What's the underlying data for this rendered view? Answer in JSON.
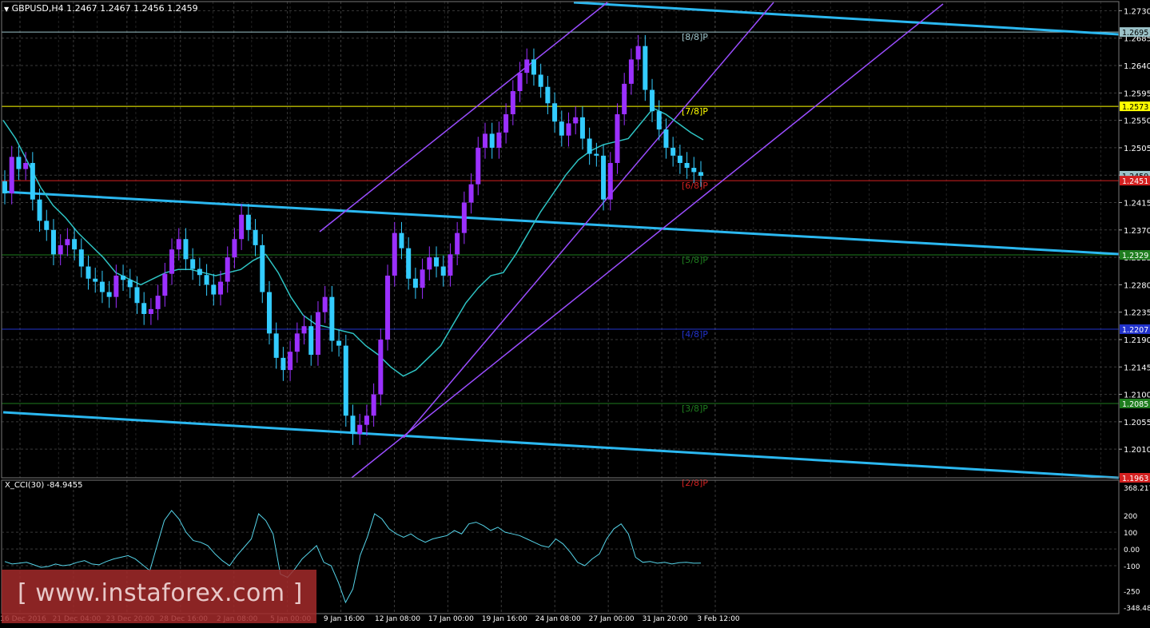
{
  "header": {
    "symbol_label": "GBPUSD,H4  1.2467 1.2467 1.2456 1.2459"
  },
  "indicator": {
    "label": "X_CCI(30) -84.9455"
  },
  "watermark": {
    "text": "[ www.instaforex.com ]"
  },
  "colors": {
    "background": "#000000",
    "grid": "#3a3a3a",
    "bull_candle": "#9b30ff",
    "bear_candle": "#33ccff",
    "ma_line": "#2ec4c4",
    "regression_channel": "#2bb8f0",
    "up_channel": "#9a4dff",
    "cci_line": "#55d3e8",
    "level_8_8": "#9cc3c9",
    "level_7_8": "#ffff00",
    "level_6_8": "#d42020",
    "level_5_8": "#1e7d1e",
    "level_4_8": "#2233cc",
    "level_3_8": "#1e7d1e",
    "level_2_8": "#d42020"
  },
  "chart_data": {
    "type": "candlestick",
    "symbol": "GBPUSD",
    "timeframe": "H4",
    "ohlc_current": [
      1.2467,
      1.2467,
      1.2456,
      1.2459
    ],
    "price_axis_ticks": [
      "1.2730",
      "1.2685",
      "1.2640",
      "1.2595",
      "1.2550",
      "1.2505",
      "1.2460",
      "1.2415",
      "1.2370",
      "1.2325",
      "1.2280",
      "1.2235",
      "1.2190",
      "1.2145",
      "1.2100",
      "1.2055",
      "1.2010"
    ],
    "ylim": [
      1.1963,
      1.2745
    ],
    "time_axis_labels": [
      "16 Dec 2016",
      "21 Dec 04:00",
      "23 Dec 20:00",
      "28 Dec 16:00",
      "2 Jan 08:00",
      "5 Jan 00:00",
      "9 Jan 16:00",
      "12 Jan 08:00",
      "17 Jan 00:00",
      "19 Jan 16:00",
      "24 Jan 08:00",
      "27 Jan 00:00",
      "31 Jan 20:00",
      "3 Feb 12:00"
    ],
    "price_tags": [
      {
        "value": "1.2695",
        "level": 1.2695
      },
      {
        "value": "1.2573",
        "level": 1.2573
      },
      {
        "value": "1.2459",
        "level": 1.2459
      },
      {
        "value": "1.2451",
        "level": 1.2451
      },
      {
        "value": "1.2329",
        "level": 1.2329
      },
      {
        "value": "1.2207",
        "level": 1.2207
      },
      {
        "value": "1.2085",
        "level": 1.2085
      },
      {
        "value": "1.1963",
        "level": 1.1963
      }
    ],
    "murrey_levels": [
      {
        "label": "[8/8]P",
        "value": 1.2695
      },
      {
        "label": "[7/8]P",
        "value": 1.2573
      },
      {
        "label": "[6/8]P",
        "value": 1.2451
      },
      {
        "label": "[5/8]P",
        "value": 1.2329
      },
      {
        "label": "[4/8]P",
        "value": 1.2207
      },
      {
        "label": "[3/8]P",
        "value": 1.2085
      },
      {
        "label": "[2/8]P",
        "value": 1.1963
      }
    ],
    "closes": [
      1.243,
      1.249,
      1.247,
      1.248,
      1.242,
      1.2385,
      1.237,
      1.233,
      1.2345,
      1.2355,
      1.2338,
      1.231,
      1.229,
      1.2285,
      1.2268,
      1.226,
      1.2295,
      1.2288,
      1.2276,
      1.225,
      1.2232,
      1.224,
      1.2262,
      1.2298,
      1.2338,
      1.2355,
      1.2322,
      1.2306,
      1.2296,
      1.228,
      1.2264,
      1.2285,
      1.2325,
      1.2355,
      1.2395,
      1.237,
      1.2345,
      1.2268,
      1.22,
      1.216,
      1.214,
      1.217,
      1.22,
      1.2212,
      1.2165,
      1.2235,
      1.226,
      1.2188,
      1.218,
      1.2065,
      1.2035,
      1.205,
      1.2065,
      1.21,
      1.219,
      1.2295,
      1.2365,
      1.234,
      1.229,
      1.2275,
      1.2305,
      1.2325,
      1.231,
      1.2295,
      1.233,
      1.2365,
      1.2415,
      1.2445,
      1.2505,
      1.2528,
      1.2505,
      1.253,
      1.256,
      1.2598,
      1.2628,
      1.265,
      1.2625,
      1.2605,
      1.2578,
      1.2548,
      1.2525,
      1.2545,
      1.2555,
      1.252,
      1.2495,
      1.2492,
      1.242,
      1.248,
      1.256,
      1.261,
      1.265,
      1.2672,
      1.26,
      1.2565,
      1.2535,
      1.2505,
      1.2492,
      1.248,
      1.2472,
      1.2465,
      1.2459
    ],
    "cci": {
      "name": "X_CCI(30)",
      "last": -84.9455,
      "ticks": [
        "368.2178",
        "200",
        "100",
        "0.00",
        "-100",
        "-250",
        "-348.4884"
      ],
      "values": [
        -75,
        -90,
        -85,
        -80,
        -95,
        -110,
        -105,
        -90,
        -100,
        -95,
        -80,
        -70,
        -90,
        -95,
        -75,
        -60,
        -50,
        -40,
        -60,
        -95,
        -130,
        20,
        170,
        230,
        180,
        100,
        50,
        40,
        20,
        -30,
        -70,
        -100,
        -40,
        10,
        60,
        210,
        170,
        90,
        -150,
        -170,
        -120,
        -60,
        -20,
        20,
        -80,
        -100,
        -200,
        -320,
        -240,
        -40,
        70,
        210,
        180,
        120,
        90,
        70,
        90,
        60,
        40,
        60,
        70,
        80,
        110,
        90,
        150,
        160,
        140,
        110,
        130,
        100,
        90,
        80,
        60,
        40,
        20,
        10,
        60,
        30,
        -20,
        -80,
        -100,
        -60,
        -30,
        60,
        120,
        150,
        90,
        -50,
        -80,
        -75,
        -85,
        -80,
        -90,
        -82,
        -80,
        -85,
        -84.9455
      ]
    },
    "ma_values": [
      1.255,
      1.252,
      1.248,
      1.244,
      1.241,
      1.239,
      1.2365,
      1.2345,
      1.2325,
      1.23,
      1.229,
      1.228,
      1.229,
      1.23,
      1.2305,
      1.2305,
      1.23,
      1.2295,
      1.23,
      1.2305,
      1.232,
      1.233,
      1.23,
      1.226,
      1.223,
      1.2215,
      1.221,
      1.2205,
      1.22,
      1.218,
      1.2165,
      1.2145,
      1.213,
      1.214,
      1.216,
      1.218,
      1.2215,
      1.225,
      1.2275,
      1.2295,
      1.23,
      1.233,
      1.2365,
      1.24,
      1.243,
      1.246,
      1.2485,
      1.25,
      1.251,
      1.2515,
      1.252,
      1.2545,
      1.257,
      1.256,
      1.2545,
      1.253,
      1.2518
    ]
  }
}
